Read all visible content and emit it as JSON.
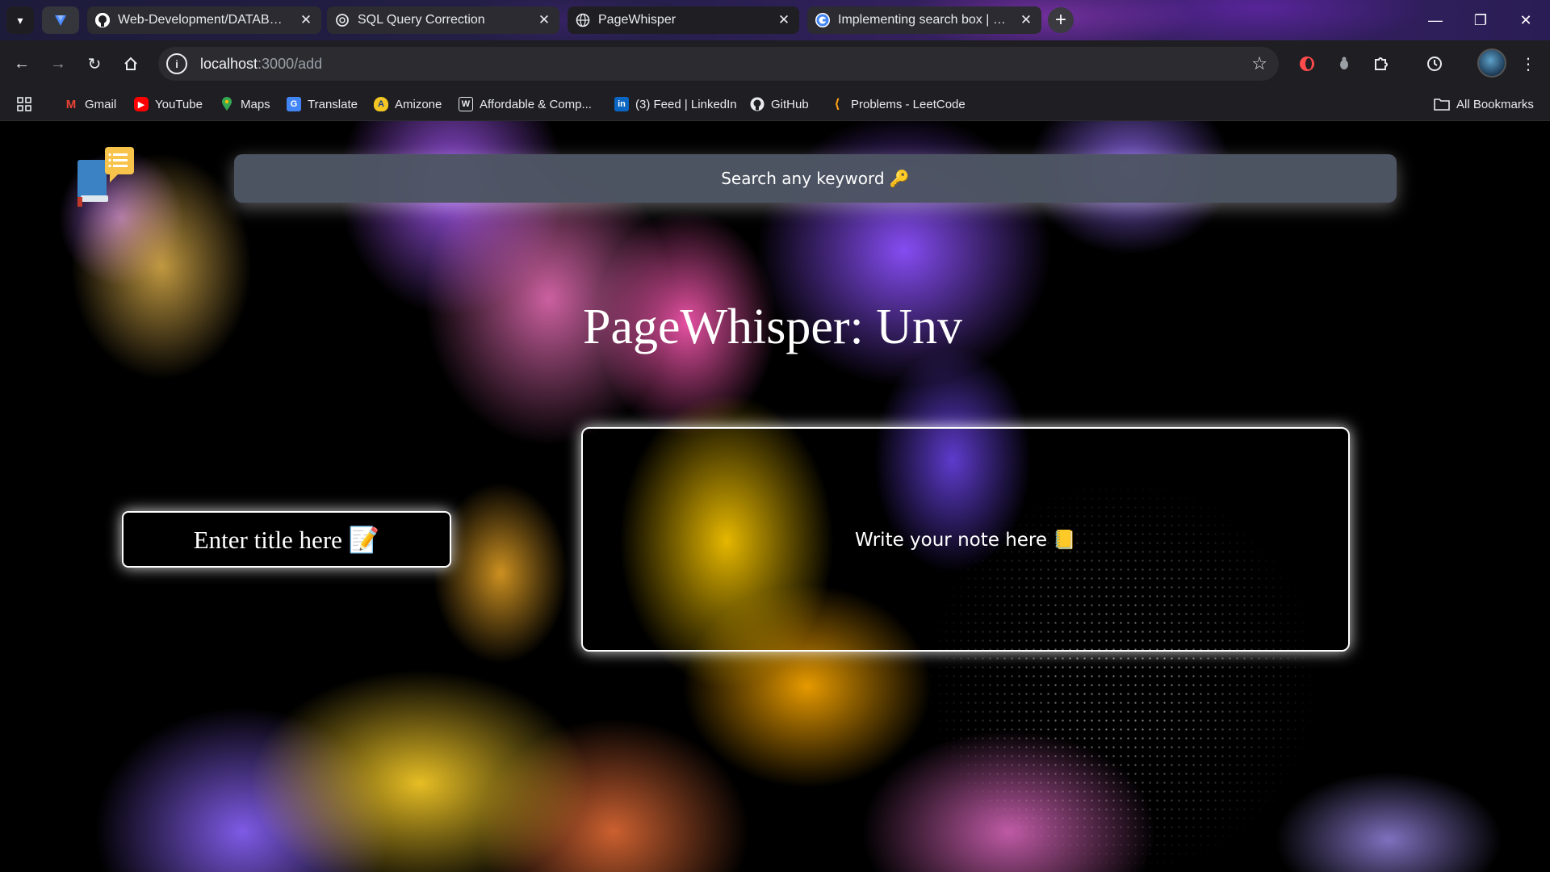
{
  "browser": {
    "tabs": [
      {
        "title": "Web-Development/DATABASE/",
        "icon": "github-icon",
        "active": false
      },
      {
        "title": "SQL Query Correction",
        "icon": "openai-icon",
        "active": false
      },
      {
        "title": "PageWhisper",
        "icon": "globe-icon",
        "active": true
      },
      {
        "title": "Implementing search box | Pro",
        "icon": "google-icon",
        "active": false
      }
    ],
    "new_tab_label": "+",
    "url_host": "localhost",
    "url_path": ":3000/add"
  },
  "bookmarks": {
    "items": [
      {
        "label": "Gmail",
        "icon": "gmail-icon"
      },
      {
        "label": "YouTube",
        "icon": "youtube-icon"
      },
      {
        "label": "Maps",
        "icon": "maps-icon"
      },
      {
        "label": "Translate",
        "icon": "translate-icon"
      },
      {
        "label": "Amizone",
        "icon": "amizone-icon"
      },
      {
        "label": "Affordable & Comp...",
        "icon": "affordable-icon"
      },
      {
        "label": "(3) Feed | LinkedIn",
        "icon": "linkedin-icon"
      },
      {
        "label": "GitHub",
        "icon": "github-icon"
      },
      {
        "label": "Problems - LeetCode",
        "icon": "leetcode-icon"
      }
    ],
    "all_bookmarks": "All Bookmarks"
  },
  "page": {
    "search_placeholder": "Search any keyword 🔑",
    "heading": "PageWhisper: Unv",
    "title_placeholder": "Enter title here 📝",
    "note_placeholder": "Write your note here 📒"
  },
  "colors": {
    "search_bg": "#4e5664",
    "box_bg": "#000000",
    "glow": "#ffffff"
  }
}
